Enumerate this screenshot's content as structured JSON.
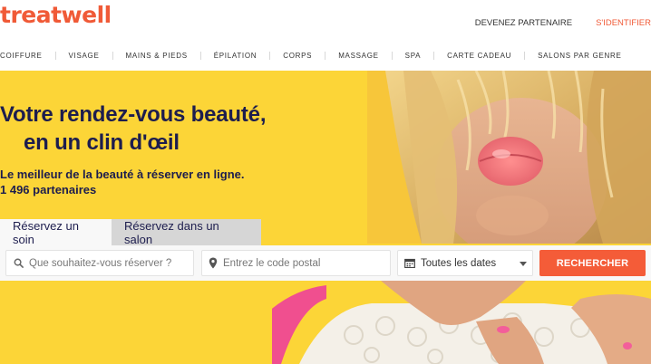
{
  "header": {
    "logo": "treatwell",
    "logo_color": "#f05a37",
    "links": [
      {
        "label": "DEVENEZ PARTENAIRE"
      },
      {
        "label": "S'IDENTIFIER"
      }
    ]
  },
  "nav": {
    "items": [
      "COIFFURE",
      "VISAGE",
      "MAINS & PIEDS",
      "ÉPILATION",
      "CORPS",
      "MASSAGE",
      "SPA",
      "CARTE CADEAU",
      "SALONS PAR GENRE"
    ]
  },
  "hero": {
    "headline_line1": "Votre rendez-vous beauté,",
    "headline_line2": "en un clin d'œil",
    "subline_line1": "Le meilleur de la beauté à réserver en ligne.",
    "subline_line2": "1 496 partenaires",
    "background_color": "#fcd537"
  },
  "tabs": [
    {
      "label": "Réservez un soin"
    },
    {
      "label": "Réservez dans un salon"
    }
  ],
  "search": {
    "what_placeholder": "Que souhaitez-vous réserver ?",
    "where_placeholder": "Entrez le code postal",
    "date_value": "Toutes les dates",
    "button_label": "RECHERCHER",
    "button_color": "#f45c38",
    "icons": [
      "search-icon",
      "location-pin-icon",
      "calendar-icon",
      "chevron-down-icon"
    ]
  }
}
